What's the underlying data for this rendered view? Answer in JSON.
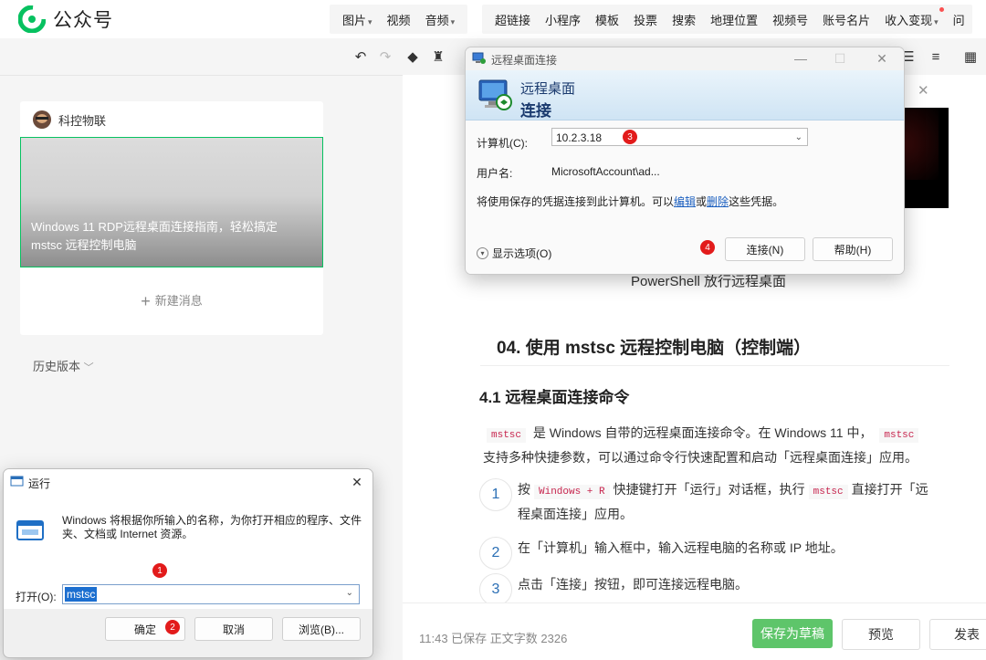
{
  "topbar": {
    "logo_text": "公众号",
    "menu_group1": [
      "图片",
      "视频",
      "音频"
    ],
    "menu_group2": [
      "超链接",
      "小程序",
      "模板",
      "投票",
      "搜索",
      "地理位置",
      "视频号",
      "账号名片",
      "收入变现",
      "问"
    ]
  },
  "card": {
    "account_name": "科控物联",
    "cover_title": "Windows 11 RDP远程桌面连接指南，轻松搞定 mstsc 远程控制电脑",
    "new_message": "新建消息"
  },
  "history": "历史版本",
  "editor": {
    "caption": "PowerShell 放行远程桌面",
    "heading2": "04. 使用 mstsc 远程控制电脑（控制端）",
    "heading3": "4.1 远程桌面连接命令",
    "para_code": "mstsc",
    "para_text1": "是 Windows 自带的远程桌面连接命令。在 Windows 11 中，",
    "para_code2": "mstsc",
    "para_text2": "支持多种快捷参数，可以通过命令行快速配置和启动「远程桌面连接」应用。",
    "steps": [
      {
        "num": "1",
        "pre": "按",
        "code1": "Windows + R",
        "mid": "快捷键打开「运行」对话框，执行",
        "code2": "mstsc",
        "post": "直接打开「远程桌面连接」应用。"
      },
      {
        "num": "2",
        "text": "在「计算机」输入框中，输入远程电脑的名称或 IP 地址。"
      },
      {
        "num": "3",
        "text": "点击「连接」按钮，即可连接远程电脑。"
      }
    ]
  },
  "bottombar": {
    "status": "11:43  已保存   正文字数  2326",
    "save_draft": "保存为草稿",
    "preview": "预览",
    "publish": "发表"
  },
  "rdp_dialog": {
    "title": "远程桌面连接",
    "banner_line1": "远程桌面",
    "banner_line2": "连接",
    "computer_label": "计算机(C):",
    "computer_value": "10.2.3.18",
    "username_label": "用户名:",
    "username_value": "MicrosoftAccount\\ad...",
    "cred_text1": "将使用保存的凭据连接到此计算机。可以",
    "cred_edit": "编辑",
    "cred_or": "或",
    "cred_delete": "删除",
    "cred_text2": "这些凭据。",
    "show_options": "显示选项(O)",
    "connect": "连接(N)",
    "help": "帮助(H)"
  },
  "run_dialog": {
    "title": "运行",
    "description": "Windows 将根据你所输入的名称，为你打开相应的程序、文件夹、文档或 Internet 资源。",
    "open_label": "打开(O):",
    "open_value": "mstsc",
    "ok": "确定",
    "cancel": "取消",
    "browse": "浏览(B)..."
  },
  "badges": [
    "1",
    "2",
    "3",
    "4"
  ],
  "colors": {
    "brand_green": "#07c160",
    "save_button": "#5ec56a",
    "badge_red": "#e21b1b",
    "link_blue": "#1b5fbf"
  }
}
